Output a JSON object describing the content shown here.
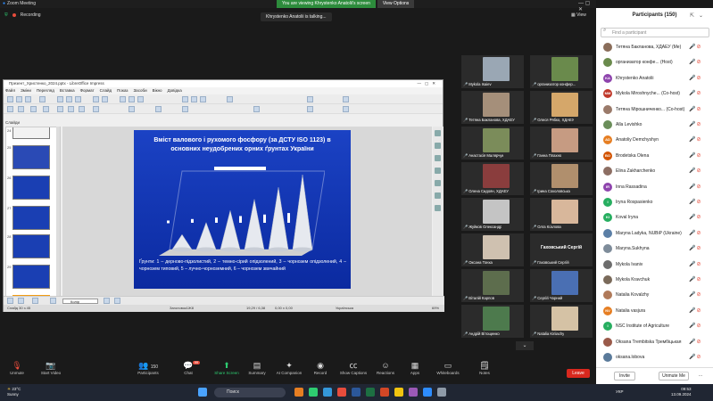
{
  "window": {
    "title": "Zoom Meeting",
    "banner_text": "You are viewing Khrystenko Anatolii's screen",
    "view_options": "View Options",
    "controls": "—  ▢  ✕"
  },
  "top": {
    "recording": "Recording",
    "view": "View",
    "talking": "Khrystenko Anatolii is talking..."
  },
  "impress": {
    "title": "Презент_Христенко_2024.pptx - LibreOffice Impress",
    "menu": [
      "Файл",
      "Зміни",
      "Перегляд",
      "Вставка",
      "Формат",
      "Слайд",
      "Показ",
      "Засоби",
      "Вікно",
      "Довідка"
    ],
    "slides_label": "Слайди",
    "thumb_numbers": [
      "24",
      "25",
      "26",
      "27",
      "28",
      "29",
      "30"
    ],
    "color_name": "Колір",
    "status": {
      "slide": "Слайд 30 з 45",
      "layout": "Заголовок1Ж8",
      "coords": "19,29 / 6,38",
      "size": "0,00 x 0,00",
      "lang": "Українська",
      "zoom": "69%"
    },
    "slide": {
      "title": "Вміст валового і рухомого фосфору (за ДСТУ ISO 1123) в основних неудобрених орних ґрунтах України",
      "caption": "Ґрунти: 1 – дерново-підзолистий, 2 – темно-сірий опідзолений, 3 – чорнозем опідзолений, 4 – чорнозем типовий, 5 – лучно-чорноземний, 6 – чорнозем звичайний"
    }
  },
  "chart_data": {
    "type": "bar",
    "categories": [
      "1",
      "2",
      "3",
      "4",
      "5",
      "6"
    ],
    "series": [
      {
        "values": [
          2.0,
          3.6,
          5.2,
          6.7,
          8.3,
          10.0
        ]
      },
      {
        "values": [
          0.3,
          0.5,
          0.7,
          0.9,
          1.1,
          1.3
        ]
      }
    ]
  },
  "tiles": [
    {
      "name": "Mykola Isaiev",
      "color": "#9aa7b4"
    },
    {
      "name": "организатор конфер...",
      "color": "#6a8a4c"
    },
    {
      "name": "Тетяна Бакланова, ХДАЕУ",
      "color": "#a58f7a"
    },
    {
      "name": "Олеся Рябко, ХДАЕУ",
      "color": "#d5a76a"
    },
    {
      "name": "Анастасія Малярчук",
      "color": "#7b8c5a"
    },
    {
      "name": "Ганна Плахно",
      "color": "#c69b82"
    },
    {
      "name": "Олена Сидоян, ХДАЕУ",
      "color": "#8a3d3d"
    },
    {
      "name": "Ірина Соколовська",
      "color": "#b08f6d"
    },
    {
      "name": "Жуйков Олександр",
      "color": "#c4c4c4"
    },
    {
      "name": "Олга Козлова",
      "color": "#d8b79b"
    },
    {
      "name": "Оксана Тонха",
      "color": "#cfc1b0"
    },
    {
      "name": "Гаховський Сергій",
      "color": "#2b2b2b"
    },
    {
      "name": "Віталій Карпов",
      "color": "#5d6d4d"
    },
    {
      "name": "Сергій Чорний",
      "color": "#4a6fb3"
    },
    {
      "name": "Андрій Вітощенко",
      "color": "#4d7a4d"
    },
    {
      "name": "Natalia Kiriiachy",
      "color": "#d5c2a5"
    }
  ],
  "tile_big_name": "Гаховський Сергій",
  "participants": {
    "title": "Participants (150)",
    "find_placeholder": "Find a participant",
    "list": [
      {
        "name": "Тетяна Бакланова, ХДАЕУ (Me)",
        "initials": "",
        "color": "#8a6d5a"
      },
      {
        "name": "организатор конфе... (Host)",
        "initials": "",
        "color": "#6a8a4c"
      },
      {
        "name": "Khrystenko Anatolii",
        "initials": "KA",
        "color": "#8e44ad"
      },
      {
        "name": "Mykola Miroshnyche... (Co-host)",
        "initials": "MM",
        "color": "#c0392b"
      },
      {
        "name": "Тетяна Мірошниченко... (Co-host)",
        "initials": "",
        "color": "#9a7a6a"
      },
      {
        "name": "Alla Levishko",
        "initials": "",
        "color": "#6b8e5a"
      },
      {
        "name": "Anatoliy Demchyshyn",
        "initials": "AD",
        "color": "#e67e22"
      },
      {
        "name": "Brodetska Olena",
        "initials": "BO",
        "color": "#d35400"
      },
      {
        "name": "Elina Zakharchenko",
        "initials": "",
        "color": "#8d6e63"
      },
      {
        "name": "Inna Rassadina",
        "initials": "IR",
        "color": "#8e44ad"
      },
      {
        "name": "Iryna Rospasienko",
        "initials": "I",
        "color": "#27ae60"
      },
      {
        "name": "Koval Iryna",
        "initials": "KI",
        "color": "#27ae60"
      },
      {
        "name": "Maryna Ladyka, NUBiP (Ukraine)",
        "initials": "",
        "color": "#5b7fa6"
      },
      {
        "name": "Maryna.Sukhyna",
        "initials": "",
        "color": "#7e8c9a"
      },
      {
        "name": "Mykola Ivaniv",
        "initials": "",
        "color": "#6d6d6d"
      },
      {
        "name": "Mykola Kravchuk",
        "initials": "",
        "color": "#7a6a5a"
      },
      {
        "name": "Natalia Kovalzhy",
        "initials": "",
        "color": "#b07a5a"
      },
      {
        "name": "Natalia vasjura",
        "initials": "NV",
        "color": "#e67e22"
      },
      {
        "name": "NSC Institute of Agriculture",
        "initials": "I",
        "color": "#27ae60"
      },
      {
        "name": "Oksana Trembitska Трембіцькая",
        "initials": "",
        "color": "#9a5a4a"
      },
      {
        "name": "oksana.lobova",
        "initials": "",
        "color": "#5a7a9a"
      }
    ],
    "invite": "Invite",
    "unmute_me": "Unmute Me"
  },
  "meeting_bar": {
    "unmute": "Unmute",
    "start_video": "Start Video",
    "participants": "Participants",
    "participants_count": "150",
    "chat": "Chat",
    "chat_badge": "99",
    "share": "Share Screen",
    "summary": "Summary",
    "ai": "AI Companion",
    "record": "Record",
    "captions": "Show Captions",
    "reactions": "Reactions",
    "apps": "Apps",
    "whiteboards": "Whiteboards",
    "notes": "Notes",
    "leave": "Leave"
  },
  "taskbar": {
    "temp": "23°C",
    "weather": "Sunny",
    "search": "Поиск",
    "lang": "УКР",
    "time": "09:53",
    "date": "13.09.2024"
  }
}
